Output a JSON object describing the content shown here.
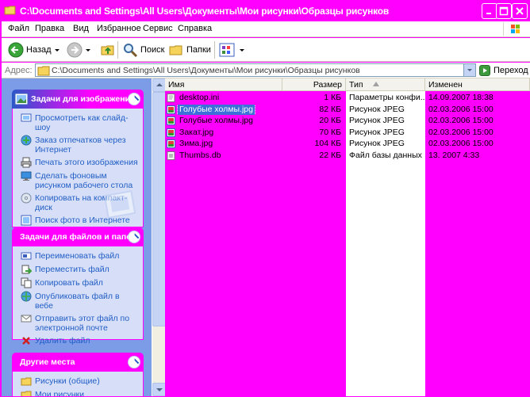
{
  "window": {
    "title": "C:\\Documents and Settings\\All Users\\Документы\\Мои рисунки\\Образцы рисунков",
    "accent_color": "#ff00ff"
  },
  "menu": {
    "items": [
      "Файл",
      "Правка",
      "Вид",
      "Избранное",
      "Сервис",
      "Справка"
    ]
  },
  "toolbar": {
    "back_label": "Назад",
    "search_label": "Поиск",
    "folders_label": "Папки"
  },
  "address": {
    "label": "Адрес:",
    "path": "C:\\Documents and Settings\\All Users\\Документы\\Мои рисунки\\Образцы рисунков",
    "go_label": "Переход"
  },
  "taskpane": {
    "image_tasks": {
      "title": "Задачи для изображений",
      "items": [
        {
          "label": "Просмотреть как слайд-шоу",
          "icon": "slideshow-icon"
        },
        {
          "label": "Заказ отпечатков через Интернет",
          "icon": "order-prints-icon"
        },
        {
          "label": "Печать этого изображения",
          "icon": "print-icon"
        },
        {
          "label": "Сделать фоновым рисунком рабочего стола",
          "icon": "wallpaper-icon"
        },
        {
          "label": "Копировать на компакт-диск",
          "icon": "cd-icon"
        },
        {
          "label": "Поиск фото в Интернете",
          "icon": "web-photo-icon"
        }
      ]
    },
    "file_tasks": {
      "title": "Задачи для файлов и папок",
      "items": [
        {
          "label": "Переименовать файл",
          "icon": "rename-icon"
        },
        {
          "label": "Переместить файл",
          "icon": "move-icon"
        },
        {
          "label": "Копировать файл",
          "icon": "copy-icon"
        },
        {
          "label": "Опубликовать файл в вебе",
          "icon": "publish-icon"
        },
        {
          "label": "Отправить этот файл по электронной почте",
          "icon": "email-icon"
        },
        {
          "label": "Удалить файл",
          "icon": "delete-icon"
        }
      ]
    },
    "other_places": {
      "title": "Другие места",
      "items": [
        {
          "label": "Рисунки (общие)",
          "icon": "shared-pictures-icon"
        },
        {
          "label": "Мои рисунки",
          "icon": "my-pictures-icon"
        }
      ]
    }
  },
  "filelist": {
    "columns": {
      "name": "Имя",
      "size": "Размер",
      "type": "Тип",
      "modified": "Изменен"
    },
    "rows": [
      {
        "name": "desktop.ini",
        "size": "1 КБ",
        "type": "Параметры конфи...",
        "date": "14.09.2007 18:38",
        "icon": "ini-file-icon"
      },
      {
        "name": "Голубые холмы.jpg",
        "size": "82 КБ",
        "type": "Рисунок JPEG",
        "date": "02.03.2006 15:00",
        "icon": "jpeg-file-icon",
        "selected": true
      },
      {
        "name": "Голубые холмы.jpg",
        "size": "20 КБ",
        "type": "Рисунок JPEG",
        "date": "02.03.2006 15:00",
        "icon": "jpeg-file-icon"
      },
      {
        "name": "Закат.jpg",
        "size": "70 КБ",
        "type": "Рисунок JPEG",
        "date": "02.03.2006 15:00",
        "icon": "jpeg-file-icon"
      },
      {
        "name": "Зима.jpg",
        "size": "104 КБ",
        "type": "Рисунок JPEG",
        "date": "02.03.2006 15:00",
        "icon": "jpeg-file-icon"
      },
      {
        "name": "Thumbs.db",
        "size": "22 КБ",
        "type": "Файл базы данных",
        "date": "13.    2007 4:33",
        "icon": "db-file-icon"
      }
    ]
  }
}
